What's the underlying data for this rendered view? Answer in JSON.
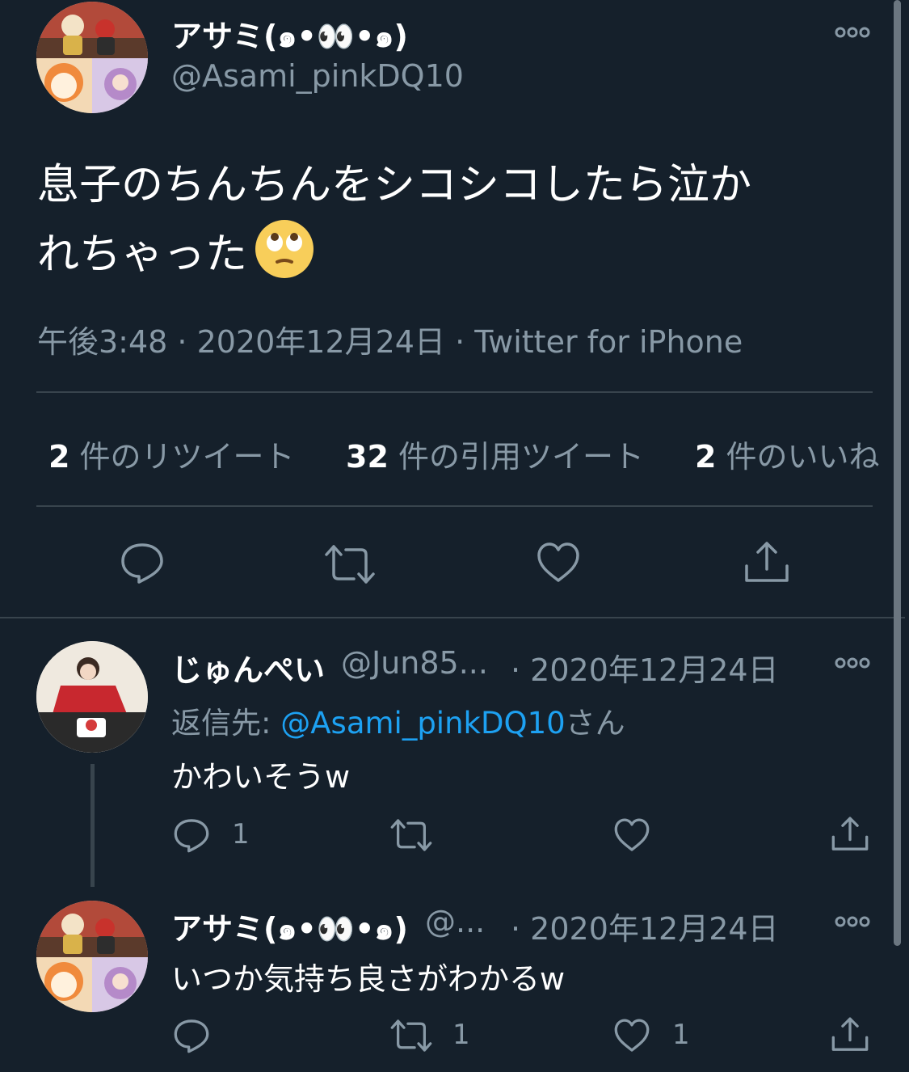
{
  "main_tweet": {
    "author_name": "アサミ(๑•👀•๑)",
    "author_handle": "@Asami_pinkDQ10",
    "text_line1": "息子のちんちんをシコシコしたら泣か",
    "text_line2": "れちゃった",
    "emoji": "🙄",
    "timestamp": "午後3:48 · 2020年12月24日 · Twitter for iPhone",
    "stats": {
      "retweets_count": "2",
      "retweets_label": "件のリツイート",
      "quotes_count": "32",
      "quotes_label": "件の引用ツイート",
      "likes_count": "2",
      "likes_label": "件のいいね"
    }
  },
  "replies": [
    {
      "author_name": "じゅんぺい",
      "author_handle": "@Jun85...",
      "date": "· 2020年12月24日",
      "reply_to_label": "返信先: ",
      "reply_to_handle": "@Asami_pinkDQ10",
      "reply_to_suffix": "さん",
      "text": "かわいそうw",
      "reply_count": "1",
      "retweet_count": "",
      "like_count": ""
    },
    {
      "author_name": "アサミ(๑•👀•๑)",
      "author_handle": "@...",
      "date": "· 2020年12月24日",
      "text": "いつか気持ち良さがわかるw",
      "reply_count": "",
      "retweet_count": "1",
      "like_count": "1"
    }
  ],
  "icons": {
    "more": "more-dots-icon",
    "reply": "reply-bubble-icon",
    "retweet": "retweet-arrows-icon",
    "like": "heart-icon",
    "share": "share-upload-icon"
  },
  "colors": {
    "background": "#15202b",
    "text": "#ffffff",
    "muted": "#8899a6",
    "link": "#1da1f2",
    "divider": "#38444d"
  }
}
